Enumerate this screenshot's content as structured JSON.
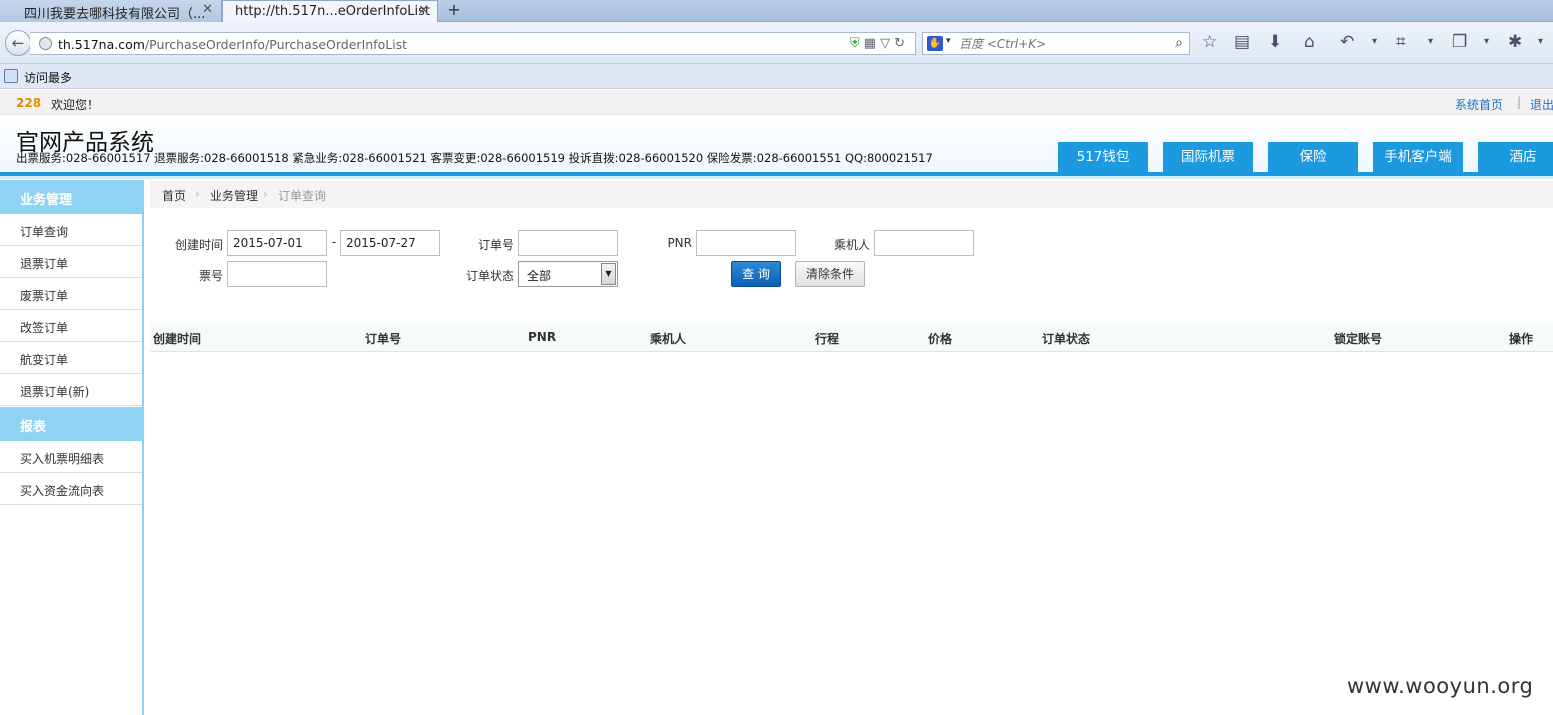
{
  "browser": {
    "tabs": [
      {
        "label": "四川我要去哪科技有限公司（...",
        "active": false
      },
      {
        "label": "http://th.517n...eOrderInfoList",
        "active": true
      }
    ],
    "url_host": "th.517na.com",
    "url_path": "/PurchaseOrderInfo/PurchaseOrderInfoList",
    "search_placeholder": "百度 <Ctrl+K>",
    "bookmark_label": "访问最多"
  },
  "sitetop": {
    "user_id": "228",
    "welcome": "欢迎您！",
    "home_link": "系统首页",
    "logout_link": "退出"
  },
  "header": {
    "title": "官网产品系统",
    "phones": "出票服务:028-66001517 退票服务:028-66001518 紧急业务:028-66001521 客票变更:028-66001519 投诉直拨:028-66001520 保险发票:028-66001551 QQ:800021517",
    "nav": [
      "517钱包",
      "国际机票",
      "保险",
      "手机客户端",
      "酒店"
    ],
    "accent": "#1b9ae0"
  },
  "sidebar": {
    "section1": "业务管理",
    "items1": [
      "订单查询",
      "退票订单",
      "废票订单",
      "改签订单",
      "航变订单",
      "退票订单(新)"
    ],
    "section2": "报表",
    "items2": [
      "买入机票明细表",
      "买入资金流向表"
    ]
  },
  "breadcrumb": [
    "首页",
    "业务管理",
    "订单查询"
  ],
  "form": {
    "created_label": "创建时间",
    "date_from": "2015-07-01",
    "date_sep": "-",
    "date_to": "2015-07-27",
    "order_no_label": "订单号",
    "pnr_label": "PNR",
    "passenger_label": "乘机人",
    "ticket_no_label": "票号",
    "status_label": "订单状态",
    "status_value": "全部",
    "query_button": "查 询",
    "clear_button": "清除条件"
  },
  "table": {
    "columns": [
      "创建时间",
      "订单号",
      "PNR",
      "乘机人",
      "行程",
      "价格",
      "订单状态",
      "锁定账号",
      "操作"
    ]
  },
  "watermark": "www.wooyun.org"
}
